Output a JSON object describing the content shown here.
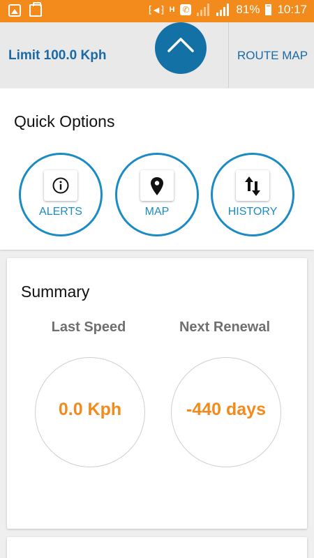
{
  "status_bar": {
    "battery_text": "81%",
    "time": "10:17",
    "icons": [
      "image-notification-icon",
      "briefcase-notification-icon",
      "vibrate-mute-icon",
      "hplus-network-icon",
      "call-icon",
      "signal-icon",
      "signal-icon",
      "battery-icon"
    ],
    "network_label": "H",
    "call_glyph": "✆",
    "mute_glyph": "⁅◄⁆"
  },
  "top_bar": {
    "limit_text": "Limit 100.0 Kph",
    "route_map_label": "ROUTE MAP"
  },
  "quick_options": {
    "title": "Quick Options",
    "items": [
      {
        "label": "ALERTS",
        "icon": "info-icon"
      },
      {
        "label": "MAP",
        "icon": "map-pin-icon"
      },
      {
        "label": "HISTORY",
        "icon": "sort-arrows-icon"
      }
    ]
  },
  "summary": {
    "title": "Summary",
    "last_speed_label": "Last Speed",
    "last_speed_value": "0.0 Kph",
    "next_renewal_label": "Next Renewal",
    "next_renewal_value": "-440 days"
  },
  "colors": {
    "status_bar": "#f28a1c",
    "accent_blue": "#1471a6",
    "option_blue": "#1a8bc4",
    "value_orange": "#f28a1c"
  }
}
